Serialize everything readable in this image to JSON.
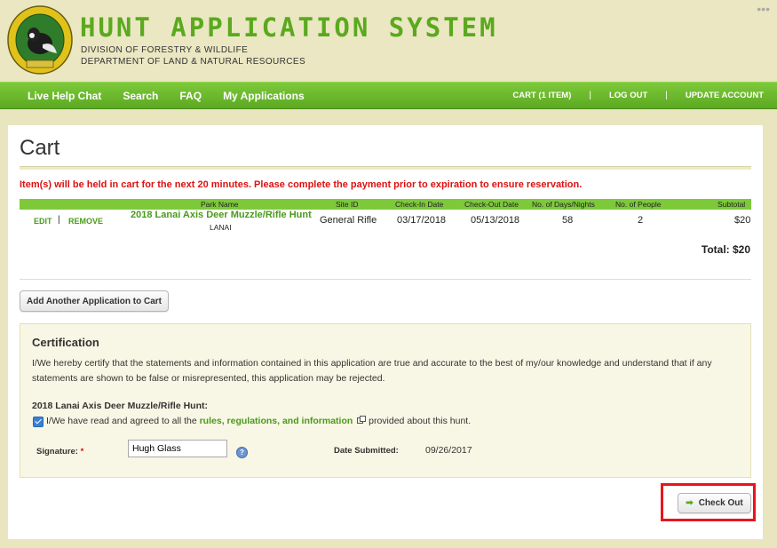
{
  "header": {
    "title": "HUNT APPLICATION SYSTEM",
    "division": "DIVISION OF FORESTRY & WILDLIFE",
    "department": "DEPARTMENT OF LAND & NATURAL RESOURCES",
    "logo_top_text": "FORESTRY AND WILDLIFE",
    "logo_bottom_text": "HAWAII",
    "more_dots": "•••"
  },
  "nav": {
    "left": [
      "Live Help Chat",
      "Search",
      "FAQ",
      "My Applications"
    ],
    "cart": "CART (1 ITEM)",
    "logout": "LOG OUT",
    "update": "UPDATE ACCOUNT",
    "separator": "|"
  },
  "page": {
    "title": "Cart",
    "notice": "Item(s) will be held in cart for the next 20 minutes. Please complete the payment prior to expiration to ensure reservation."
  },
  "table": {
    "headers": {
      "park": "Park Name",
      "site": "Site ID",
      "checkin": "Check-In Date",
      "checkout": "Check-Out Date",
      "days": "No. of Days/Nights",
      "people": "No. of People",
      "subtotal": "Subtotal"
    },
    "row": {
      "edit": "EDIT",
      "sep": "|",
      "remove": "REMOVE",
      "park": "2018 Lanai Axis Deer Muzzle/Rifle Hunt",
      "island": "LANAI",
      "site": "General Rifle",
      "checkin": "03/17/2018",
      "checkout": "05/13/2018",
      "days": "58",
      "people": "2",
      "subtotal": "$20"
    },
    "total": "Total: $20"
  },
  "add_button": "Add Another Application to Cart",
  "certification": {
    "title": "Certification",
    "text": "I/We hereby certify that the statements and information contained in this application are true and accurate to the best of my/our knowledge and understand that if any statements are shown to be false or misrepresented, this application may be rejected.",
    "hunt_label": "2018 Lanai Axis Deer Muzzle/Rifle Hunt:",
    "agree_prefix": "I/We have read and agreed to all the ",
    "agree_link": "rules, regulations, and information",
    "agree_suffix": " provided about this hunt.",
    "checked": true,
    "signature_label": "Signature:",
    "required_mark": "*",
    "signature_value": "Hugh Glass",
    "help_icon": "?",
    "date_label": "Date Submitted:",
    "date_value": "09/26/2017"
  },
  "checkout_button": "Check Out",
  "checkout_icon": "➡",
  "colors": {
    "brand_green": "#5aa91e",
    "nav_green": "#7dc93a",
    "notice_red": "#dd1111",
    "highlight_red": "#e8151d"
  }
}
